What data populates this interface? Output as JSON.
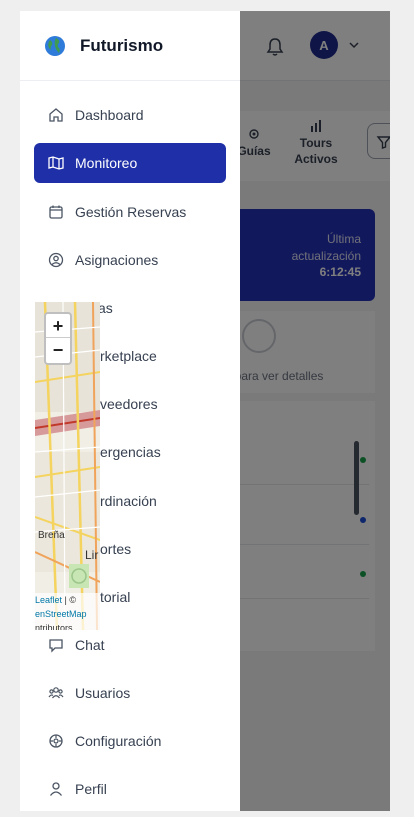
{
  "app": {
    "brand": "Futurismo",
    "avatar_initial": "A",
    "accent_color": "#1f2fa8",
    "icons": [
      "globe-icon",
      "bell-icon",
      "chevron-down-icon",
      "home-icon",
      "map-icon",
      "calendar-icon",
      "user-circle-icon",
      "users-icon",
      "settings-icon",
      "user-icon",
      "filter-icon"
    ]
  },
  "sidebar": {
    "items": [
      {
        "label": "Dashboard",
        "icon": "home-icon"
      },
      {
        "label": "Monitoreo",
        "icon": "map-icon",
        "active": true
      },
      {
        "label": "Gestión Reservas",
        "icon": "calendar-icon"
      },
      {
        "label": "Asignaciones",
        "icon": "user-circle-icon"
      },
      {
        "label": "Guías",
        "icon": "guide-icon"
      },
      {
        "label": "Marketplace",
        "icon": "store-icon"
      },
      {
        "label": "Proveedores",
        "icon": "truck-icon"
      },
      {
        "label": "Emergencias",
        "icon": "alert-icon"
      },
      {
        "label": "Coordinación",
        "icon": "coordination-icon"
      },
      {
        "label": "Reportes",
        "icon": "report-icon"
      },
      {
        "label": "Historial",
        "icon": "history-icon"
      },
      {
        "label": "Chat",
        "icon": "chat-icon"
      },
      {
        "label": "Usuarios",
        "icon": "users-icon"
      },
      {
        "label": "Configuración",
        "icon": "settings-icon"
      },
      {
        "label": "Perfil",
        "icon": "user-icon"
      }
    ],
    "visible_partial": {
      "guias": "as",
      "marketplace": "rketplace",
      "proveedores": "veedores",
      "emergencias": "ergencias",
      "coordinacion": "rdinación",
      "reportes": "ortes",
      "historial": "torial",
      "chat": "Chat"
    }
  },
  "minimap": {
    "zoom_in": "+",
    "zoom_out": "−",
    "label_brena": "Breña",
    "label_lima": "Lir",
    "attribution_leaflet": "Leaflet",
    "attribution_sep": " | ©",
    "attribution_osm": "enStreetMap",
    "attribution_contrib": "ntributors"
  },
  "background": {
    "tab_guias": "Guías",
    "tab_tours": "Tours Activos",
    "last_update_label": "Última actualización",
    "last_update_time": "6:12:45",
    "map_hint": "dor para ver detalles",
    "list_dot_colors": [
      "#16a34a",
      "#1d4ed8",
      "#16a34a"
    ]
  }
}
